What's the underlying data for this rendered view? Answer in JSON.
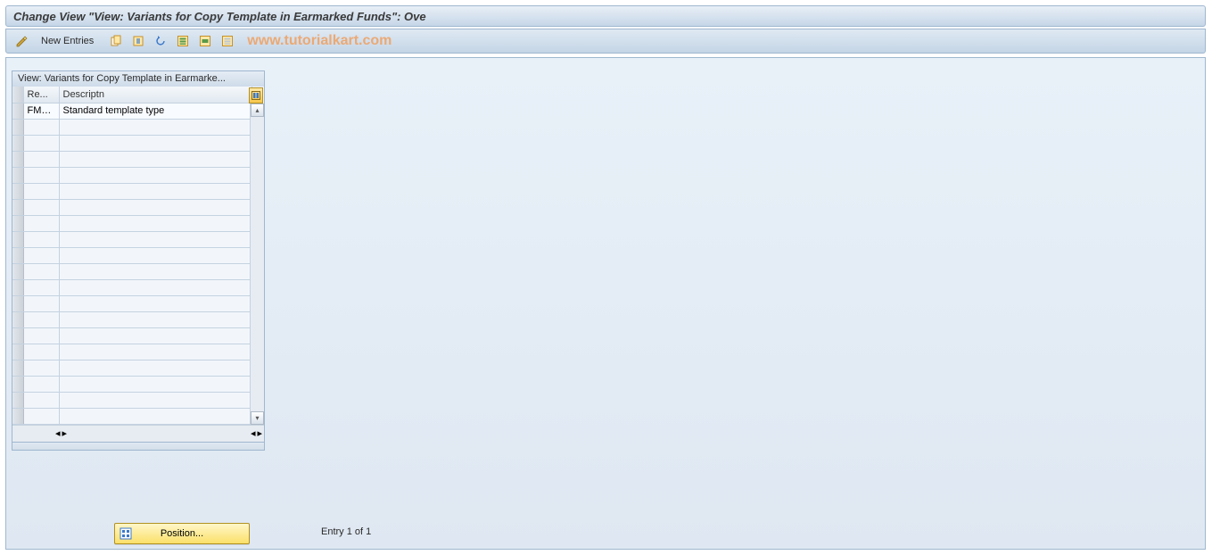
{
  "header": {
    "title": "Change View \"View: Variants for Copy Template in Earmarked Funds\": Ove"
  },
  "toolbar": {
    "new_entries_label": "New Entries"
  },
  "watermark": "www.tutorialkart.com",
  "table": {
    "panel_title": "View: Variants for Copy Template in Earmarke...",
    "columns": {
      "col1": "Re...",
      "col2": "Descriptn"
    },
    "rows": [
      {
        "re": "FMRE",
        "desc": "Standard template type"
      }
    ],
    "empty_rows": 19
  },
  "footer": {
    "position_label": "Position...",
    "entry_text": "Entry 1 of 1"
  }
}
